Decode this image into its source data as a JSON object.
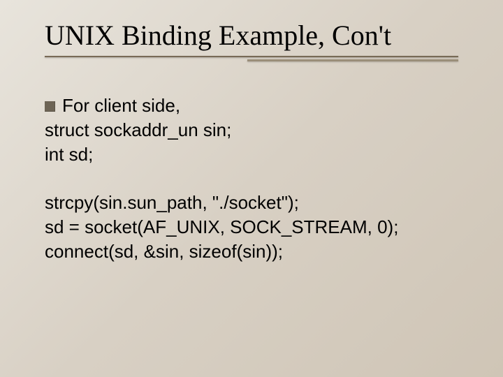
{
  "title": "UNIX Binding Example, Con't",
  "bullet": "For client side,",
  "block1": [
    "struct sockaddr_un sin;",
    "int sd;"
  ],
  "block2": [
    "strcpy(sin.sun_path, \"./socket\");",
    "sd = socket(AF_UNIX, SOCK_STREAM, 0);",
    "connect(sd, &sin, sizeof(sin));"
  ]
}
